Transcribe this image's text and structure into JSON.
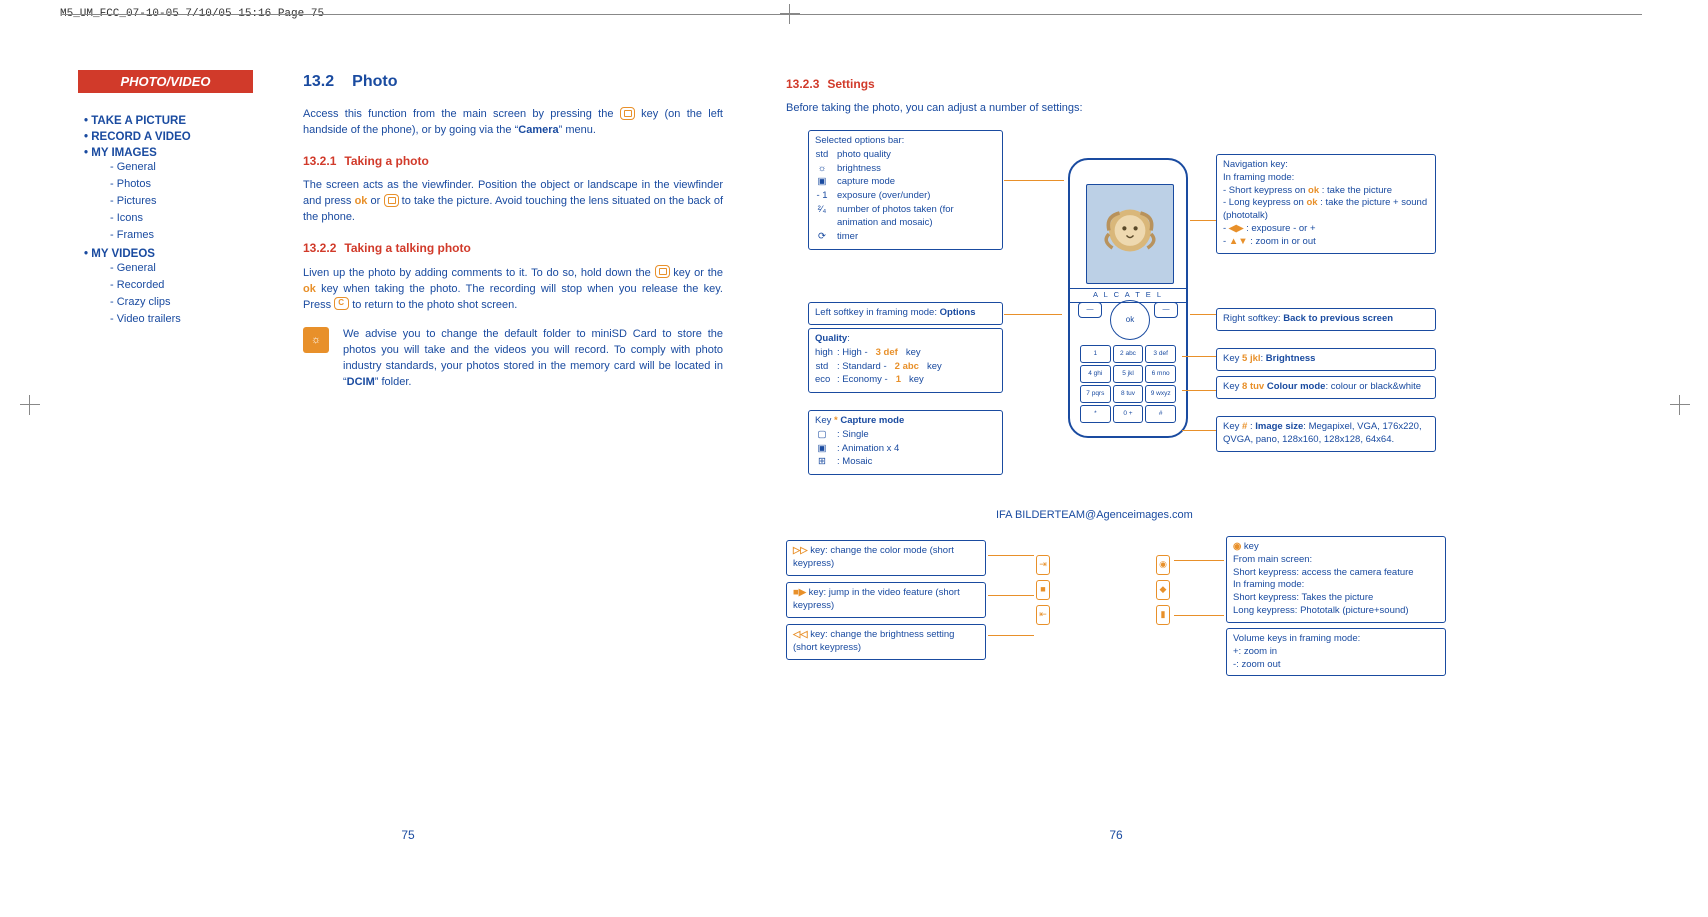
{
  "header": "M5_UM_FCC_07-10-05  7/10/05  15:16  Page 75",
  "left": {
    "tab": "PHOTO/VIDEO",
    "sidebar": [
      {
        "label": "TAKE A PICTURE",
        "sub": []
      },
      {
        "label": "RECORD A VIDEO",
        "sub": []
      },
      {
        "label": "MY IMAGES",
        "sub": [
          "General",
          "Photos",
          "Pictures",
          "Icons",
          "Frames"
        ]
      },
      {
        "label": "MY VIDEOS",
        "sub": [
          "General",
          "Recorded",
          "Crazy clips",
          "Video trailers"
        ]
      }
    ],
    "h1_num": "13.2",
    "h1": "Photo",
    "p1a": "Access this function from the main screen by pressing the ",
    "p1b": " key (on the left handside of the phone), or by going via the “",
    "p1c": "Camera",
    "p1d": "” menu.",
    "h2a_num": "13.2.1",
    "h2a": "Taking a photo",
    "p2a": "The screen acts as the viewfinder. Position the object or landscape in the viewfinder and press ",
    "ok": "ok",
    "p2b": " or ",
    "p2c": " to take the picture. Avoid touching the lens situated on the back of the phone.",
    "h2b_num": "13.2.2",
    "h2b": "Taking a talking photo",
    "p3a": "Liven up the photo by adding comments to it. To do so, hold down the ",
    "p3b": " key or the ",
    "p3c": " key when taking the photo. The recording will stop when you release the key. Press ",
    "p3d": " to return to the photo shot screen.",
    "tip": "We advise you to change the default folder to miniSD Card to store the photos you will take and the videos you will record. To comply with photo industry standards, your photos stored in the memory card will be located in “",
    "tip_bold": "DCIM",
    "tip_end": "” folder.",
    "pgnum": "75"
  },
  "right": {
    "h2c_num": "13.2.3",
    "h2c": "Settings",
    "intro": "Before taking the photo, you can adjust a number of settings:",
    "sel_title": "Selected options bar:",
    "sel": [
      {
        "ic": "std",
        "label": "photo quality"
      },
      {
        "ic": "☼",
        "label": "brightness"
      },
      {
        "ic": "▣",
        "label": "capture mode"
      },
      {
        "ic": "- 1",
        "label": "exposure (over/under)"
      },
      {
        "ic": "²⁄₄",
        "label": "number of photos taken (for animation and mosaic)"
      },
      {
        "ic": "⟳",
        "label": "timer"
      }
    ],
    "left_soft": "Left softkey in framing mode: ",
    "left_soft_b": "Options",
    "quality_title": "Quality",
    "quality": [
      {
        "ic": "high",
        "a": ": High - ",
        "k": "3 def",
        "b": " key"
      },
      {
        "ic": "std",
        "a": ": Standard - ",
        "k": "2 abc",
        "b": " key"
      },
      {
        "ic": "eco",
        "a": ": Economy - ",
        "k": "1",
        "b": " key"
      }
    ],
    "cap_title_pre": "Key ",
    "cap_key": "*",
    "cap_title": " Capture mode",
    "cap": [
      {
        "ic": "▢",
        "label": ": Single"
      },
      {
        "ic": "▣",
        "label": ": Animation x 4"
      },
      {
        "ic": "⊞",
        "label": ": Mosaic"
      }
    ],
    "nav_title": "Navigation key:",
    "nav_sub": "In framing mode:",
    "nav_items": [
      {
        "pre": "- Short keypress on ",
        "k": "ok",
        "post": " : take the picture"
      },
      {
        "pre": "- Long keypress on ",
        "k": "ok",
        "post": " : take the picture + sound (phototalk)"
      },
      {
        "pre": "- ",
        "k": "◀▶",
        "post": " : exposure - or +"
      },
      {
        "pre": "- ",
        "k": "▲▼",
        "post": " : zoom in or out"
      }
    ],
    "right_soft": "Right softkey: ",
    "right_soft_b": "Back to previous screen",
    "k5_pre": "Key ",
    "k5_k": "5 jkl",
    "k5_post": ": ",
    "k5_b": "Brightness",
    "k8_pre": "Key ",
    "k8_k": "8 tuv",
    "k8_mid": " ",
    "k8_b": "Colour mode",
    "k8_post": ": colour or black&white",
    "kh_pre": "Key ",
    "kh_k": "#",
    "kh_mid": " : ",
    "kh_b": "Image size",
    "kh_post": ": Megapixel, VGA, 176x220, QVGA, pano, 128x160, 128x128, 64x64.",
    "credit": "IFA BILDERTEAM@Agenceimages.com",
    "brand": "A L C A T E L",
    "okpad": "ok",
    "keypad": [
      "1",
      "2 abc",
      "3 def",
      "4 ghi",
      "5 jkl",
      "6 mno",
      "7 pqrs",
      "8 tuv",
      "9 wxyz",
      "*",
      "0 +",
      "#"
    ],
    "fast_fwd": " key: change the color mode (short keypress)",
    "rec": " key: jump in the video feature (short keypress)",
    "rew": " key: change the brightness setting (short keypress)",
    "cambtn_t": " key",
    "cambtn_1": "From main screen:",
    "cambtn_2": "Short keypress: access the camera feature",
    "cambtn_3": "In framing mode:",
    "cambtn_4": "Short keypress: Takes the picture",
    "cambtn_5": "Long keypress: Phototalk (picture+sound)",
    "vol_t": "Volume keys in framing mode:",
    "vol_1": "+: zoom in",
    "vol_2": "-: zoom out",
    "pgnum": "76"
  }
}
